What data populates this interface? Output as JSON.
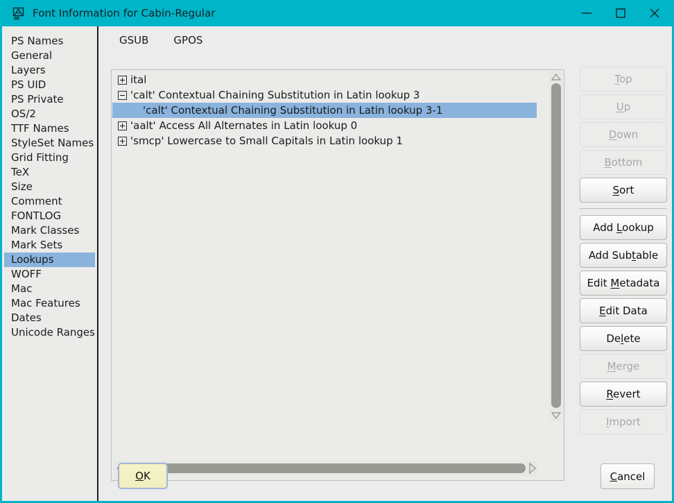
{
  "titlebar": {
    "title": "Font Information for Cabin-Regular",
    "icon": "font-glyph-icon",
    "background_color": "#00b5c8",
    "controls": {
      "minimize": "minimize-icon",
      "maximize": "maximize-icon",
      "close": "close-icon"
    }
  },
  "sidebar": {
    "selected": "Lookups",
    "selection_color": "#8ab3de",
    "items": [
      {
        "label": "PS Names"
      },
      {
        "label": "General"
      },
      {
        "label": "Layers"
      },
      {
        "label": "PS UID"
      },
      {
        "label": "PS Private"
      },
      {
        "label": "OS/2"
      },
      {
        "label": "TTF Names"
      },
      {
        "label": "StyleSet Names"
      },
      {
        "label": "Grid Fitting"
      },
      {
        "label": "TeX"
      },
      {
        "label": "Size"
      },
      {
        "label": "Comment"
      },
      {
        "label": "FONTLOG"
      },
      {
        "label": "Mark Classes"
      },
      {
        "label": "Mark Sets"
      },
      {
        "label": "Lookups"
      },
      {
        "label": "WOFF"
      },
      {
        "label": "Mac"
      },
      {
        "label": "Mac Features"
      },
      {
        "label": "Dates"
      },
      {
        "label": "Unicode Ranges"
      }
    ]
  },
  "tabs": [
    {
      "label": "GSUB",
      "selected": true
    },
    {
      "label": "GPOS",
      "selected": false
    }
  ],
  "lookup_list": {
    "selection_color": "#8ab3de",
    "rows": [
      {
        "label": "ital",
        "state": "collapsed",
        "level": 0,
        "selected": false
      },
      {
        "label": "'calt' Contextual Chaining Substitution in Latin lookup 3",
        "state": "expanded",
        "level": 0,
        "selected": false
      },
      {
        "label": "'calt' Contextual Chaining Substitution in Latin lookup 3-1",
        "state": "leaf",
        "level": 1,
        "selected": true
      },
      {
        "label": "'aalt' Access All Alternates in Latin lookup 0",
        "state": "collapsed",
        "level": 0,
        "selected": false
      },
      {
        "label": "'smcp' Lowercase to Small Capitals in Latin lookup 1",
        "state": "collapsed",
        "level": 0,
        "selected": false
      }
    ]
  },
  "scrollbars": {
    "vertical": {
      "up_icon": "triangle-up-icon",
      "down_icon": "triangle-down-icon",
      "thumb": "vertical-scroll-thumb"
    },
    "horizontal": {
      "left_icon": "triangle-left-icon",
      "right_icon": "triangle-right-icon",
      "thumb": "horizontal-scroll-thumb"
    }
  },
  "side_buttons": [
    {
      "label": "Top",
      "mnemonic": "T",
      "enabled": false
    },
    {
      "label": "Up",
      "mnemonic": "U",
      "enabled": false
    },
    {
      "label": "Down",
      "mnemonic": "D",
      "enabled": false
    },
    {
      "label": "Bottom",
      "mnemonic": "B",
      "enabled": false
    },
    {
      "label": "Sort",
      "mnemonic": "S",
      "enabled": true
    },
    {
      "label": "Add Lookup",
      "mnemonic": "L",
      "enabled": true
    },
    {
      "label": "Add Subtable",
      "mnemonic": "t",
      "enabled": true
    },
    {
      "label": "Edit Metadata",
      "mnemonic": "M",
      "enabled": true
    },
    {
      "label": "Edit Data",
      "mnemonic": "E",
      "enabled": true
    },
    {
      "label": "Delete",
      "mnemonic": "l",
      "enabled": true
    },
    {
      "label": "Merge",
      "mnemonic": "M",
      "enabled": false
    },
    {
      "label": "Revert",
      "mnemonic": "R",
      "enabled": true
    },
    {
      "label": "Import",
      "mnemonic": "I",
      "enabled": false
    }
  ],
  "bottom_bar": {
    "ok_label": "OK",
    "ok_mnemonic": "O",
    "cancel_label": "Cancel",
    "cancel_mnemonic": "C"
  }
}
